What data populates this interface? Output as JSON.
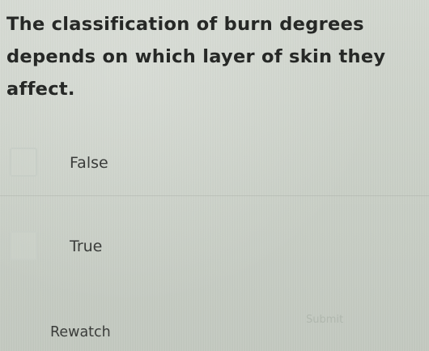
{
  "question": {
    "text": "The classification of burn degrees depends on which layer of skin they affect."
  },
  "options": [
    {
      "label": "False",
      "selected": false
    },
    {
      "label": "True",
      "selected": false
    }
  ],
  "actions": {
    "rewatch_label": "Rewatch",
    "submit_label": "Submit"
  }
}
